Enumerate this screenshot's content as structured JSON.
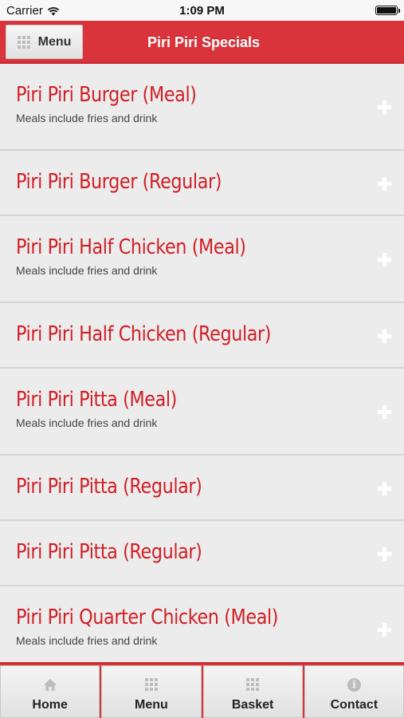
{
  "status_bar": {
    "carrier": "Carrier",
    "time": "1:09 PM"
  },
  "header": {
    "menu_label": "Menu",
    "title": "Piri Piri Specials"
  },
  "items": [
    {
      "name": "Piri Piri Burger (Meal)",
      "description": "Meals include fries and drink"
    },
    {
      "name": "Piri Piri Burger (Regular)",
      "description": ""
    },
    {
      "name": "Piri Piri Half Chicken (Meal)",
      "description": "Meals include fries and drink"
    },
    {
      "name": "Piri Piri Half Chicken (Regular)",
      "description": ""
    },
    {
      "name": "Piri Piri Pitta (Meal)",
      "description": "Meals include fries and drink"
    },
    {
      "name": "Piri Piri Pitta (Regular)",
      "description": ""
    },
    {
      "name": "Piri Piri Pitta (Regular)",
      "description": ""
    },
    {
      "name": "Piri Piri Quarter Chicken (Meal)",
      "description": "Meals include fries and drink"
    }
  ],
  "tabs": [
    {
      "label": "Home",
      "icon": "home-icon"
    },
    {
      "label": "Menu",
      "icon": "grid-icon"
    },
    {
      "label": "Basket",
      "icon": "grid-icon"
    },
    {
      "label": "Contact",
      "icon": "info-icon"
    }
  ],
  "colors": {
    "brand_red": "#d9343b",
    "item_title_red": "#d11f26"
  }
}
